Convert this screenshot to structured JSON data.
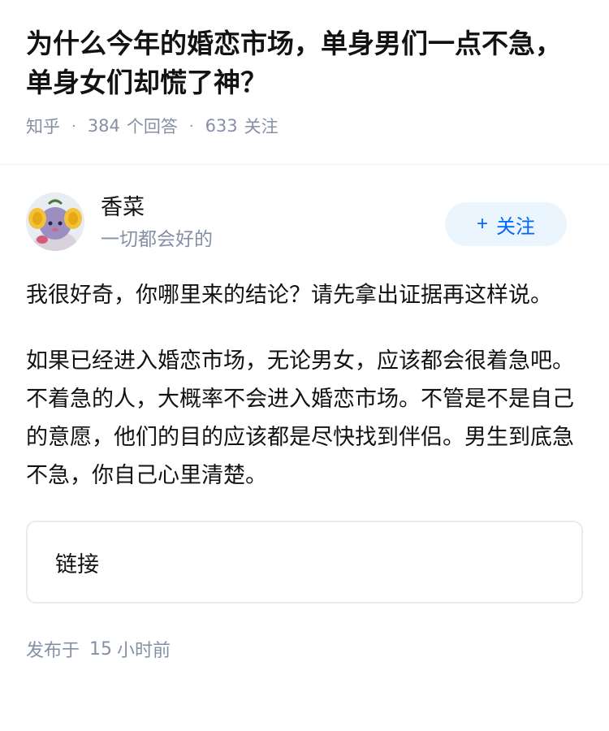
{
  "question": {
    "title": "为什么今年的婚恋市场，单身男们一点不急，单身女们却慌了神？",
    "site": "知乎",
    "answer_count": "384",
    "answer_label": "个回答",
    "follow_count": "633",
    "follow_label": "关注"
  },
  "author": {
    "name": "香菜",
    "bio": "一切都会好的",
    "avatar_icon": "avatar-character-icon",
    "follow_plus": "+",
    "follow_label": "关注"
  },
  "answer": {
    "paragraphs": [
      "我很好奇，你哪里来的结论？请先拿出证据再这样说。",
      "如果已经进入婚恋市场，无论男女，应该都会很着急吧。不着急的人，大概率不会进入婚恋市场。不管是不是自己的意愿，他们的目的应该都是尽快找到伴侣。男生到底急不急，你自己心里清楚。"
    ],
    "link_label": "链接"
  },
  "publish": {
    "prefix": "发布于",
    "time_value": "15",
    "time_unit": "小时前"
  },
  "colors": {
    "accent": "#0066ff",
    "follow_bg": "#ebf5fd",
    "meta_gray": "#8590a6",
    "text": "#121212"
  }
}
